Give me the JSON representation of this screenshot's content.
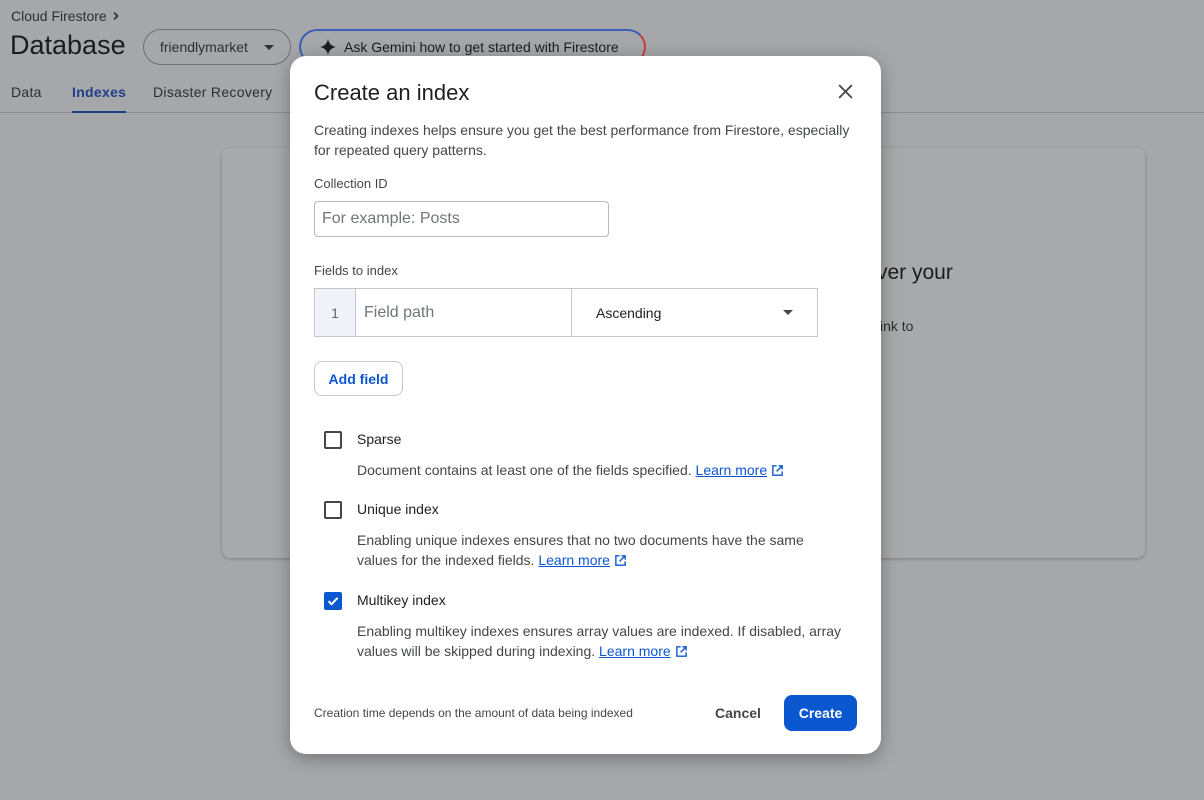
{
  "header": {
    "breadcrumb": "Cloud Firestore",
    "title": "Database",
    "database_selector": "friendlymarket",
    "gemini_button": "Ask Gemini how to get started with Firestore"
  },
  "tabs": [
    {
      "label": "Data",
      "active": false
    },
    {
      "label": "Indexes",
      "active": true
    },
    {
      "label": "Disaster Recovery",
      "active": false
    }
  ],
  "background_card": {
    "fragment_heading": "ver your",
    "fragment_text": "ink to"
  },
  "dialog": {
    "title": "Create an index",
    "description": "Creating indexes helps ensure you get the best performance from Firestore, especially for repeated query patterns.",
    "collection_id": {
      "label": "Collection ID",
      "placeholder": "For example: Posts",
      "value": ""
    },
    "fields_to_index": {
      "label": "Fields to index",
      "rows": [
        {
          "index": "1",
          "placeholder": "Field path",
          "value": "",
          "order": "Ascending"
        }
      ]
    },
    "add_field_label": "Add field",
    "options": [
      {
        "title": "Sparse",
        "checked": false,
        "description": "Document contains at least one of the fields specified.",
        "link": "Learn more"
      },
      {
        "title": "Unique index",
        "checked": false,
        "description": "Enabling unique indexes ensures that no two documents have the same values for the indexed fields.",
        "link": "Learn more"
      },
      {
        "title": "Multikey index",
        "checked": true,
        "description": "Enabling multikey indexes ensures array values are indexed. If disabled, array values will be skipped during indexing.",
        "link": "Learn more"
      }
    ],
    "footer_note": "Creation time depends on the amount of data being indexed",
    "cancel_label": "Cancel",
    "create_label": "Create"
  },
  "colors": {
    "accent": "#0b57d0",
    "overlay_background": "#a6a7aa",
    "active_tab": "#1f3f88"
  },
  "icons": [
    "chevron-right-icon",
    "dropdown-arrow-icon",
    "gemini-sparkle-icon",
    "close-icon",
    "checkmark-icon",
    "external-link-icon"
  ]
}
